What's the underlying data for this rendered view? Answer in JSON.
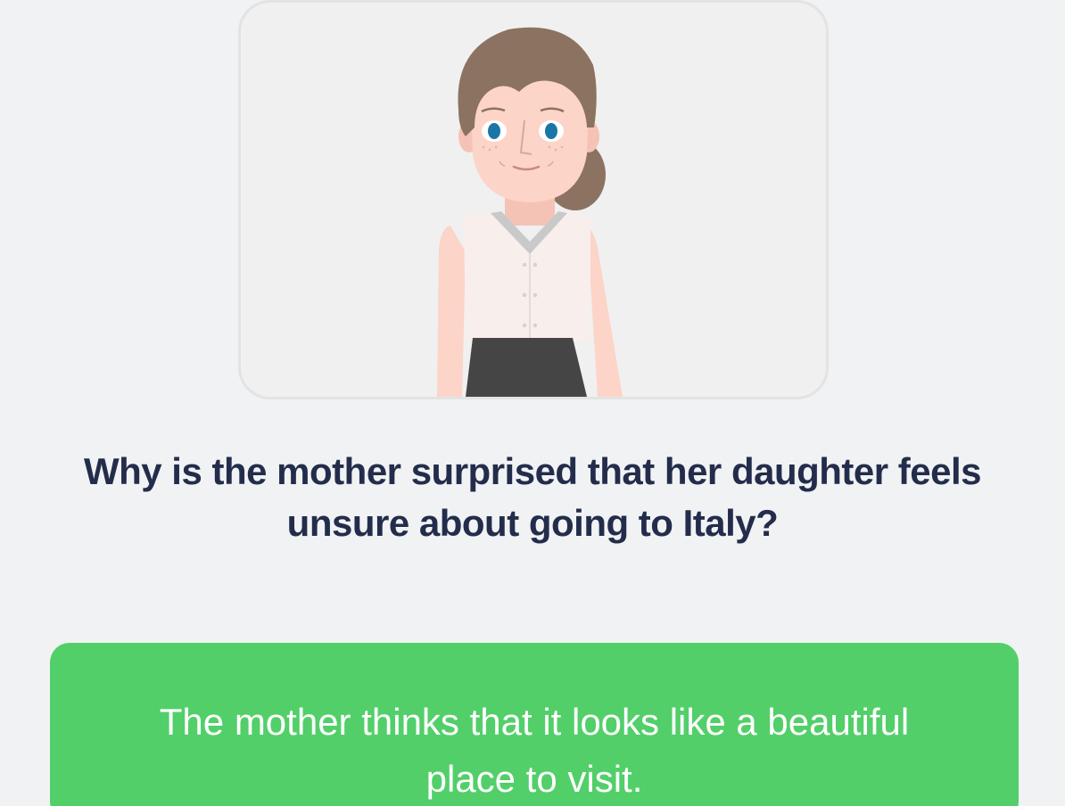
{
  "illustration": {
    "icon": "mother-character-illustration",
    "colors": {
      "hair": "#8c7260",
      "skin": "#fcd4c8",
      "eyes": "#1a76a8",
      "blouse": "#f8eeec",
      "collar": "#c9c9c9",
      "skirt": "#454545"
    }
  },
  "question": {
    "text": "Why is the mother surprised that her daughter feels unsure about going to Italy?"
  },
  "answers": [
    {
      "label": "The mother thinks that it looks like a beautiful place to visit.",
      "color": "#52cf69"
    }
  ],
  "theme": {
    "background": "#f1f2f4",
    "text_dark": "#232d4b"
  }
}
